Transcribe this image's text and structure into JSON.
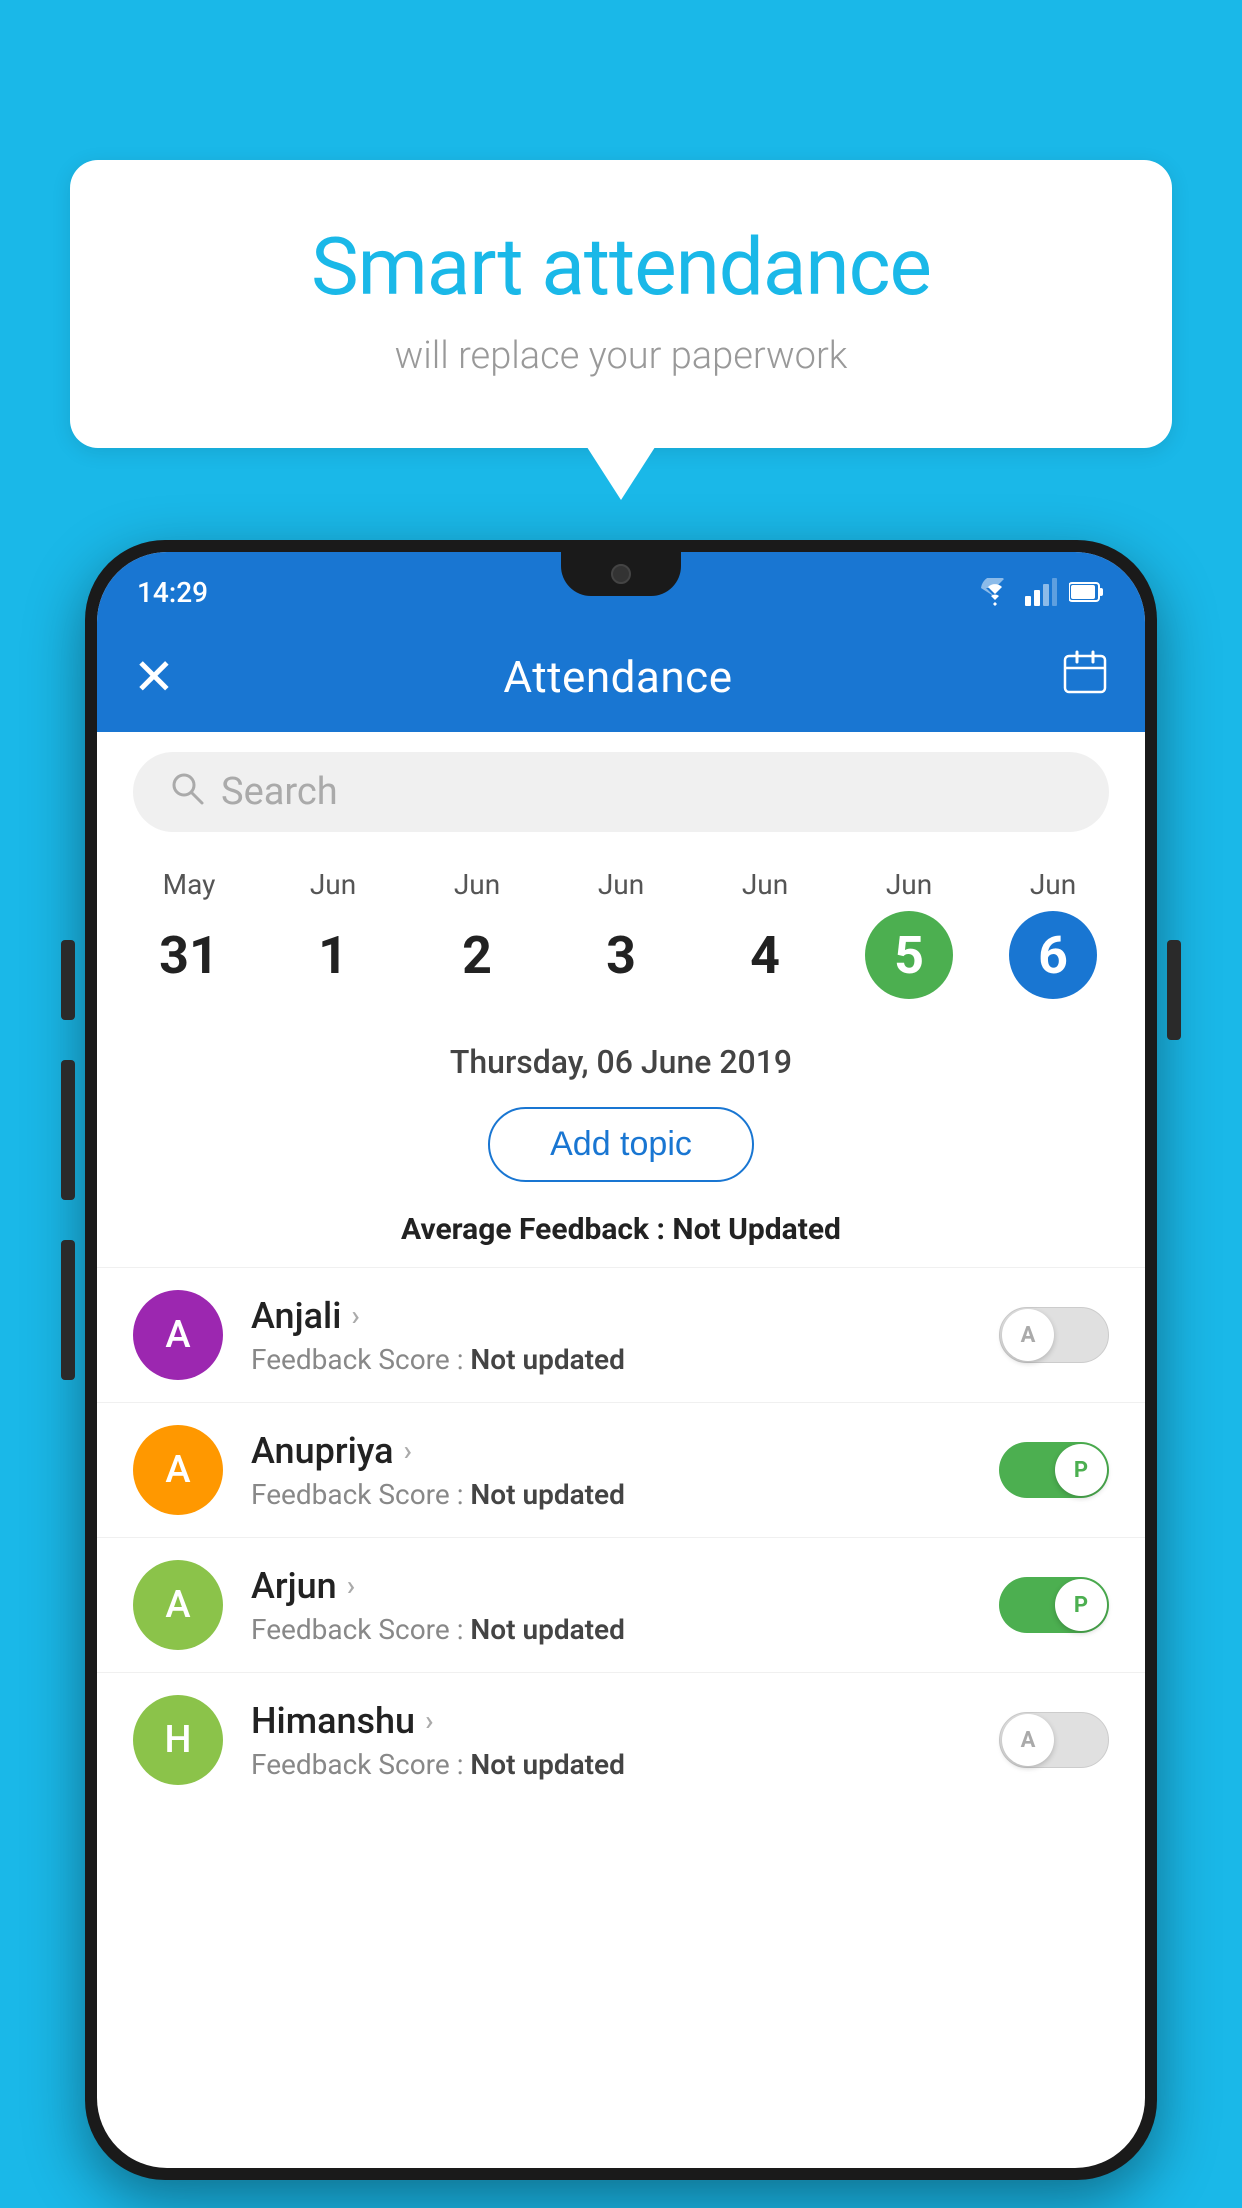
{
  "background_color": "#1ab8e8",
  "bubble": {
    "title": "Smart attendance",
    "subtitle": "will replace your paperwork"
  },
  "status_bar": {
    "time": "14:29",
    "wifi_icon": "wifi",
    "signal_icon": "signal",
    "battery_icon": "battery"
  },
  "app_bar": {
    "title": "Attendance",
    "close_icon": "×",
    "calendar_icon": "📅"
  },
  "search": {
    "placeholder": "Search"
  },
  "calendar": {
    "days": [
      {
        "month": "May",
        "num": "31",
        "style": "normal"
      },
      {
        "month": "Jun",
        "num": "1",
        "style": "normal"
      },
      {
        "month": "Jun",
        "num": "2",
        "style": "normal"
      },
      {
        "month": "Jun",
        "num": "3",
        "style": "normal"
      },
      {
        "month": "Jun",
        "num": "4",
        "style": "normal"
      },
      {
        "month": "Jun",
        "num": "5",
        "style": "green"
      },
      {
        "month": "Jun",
        "num": "6",
        "style": "blue"
      }
    ]
  },
  "selected_date": "Thursday, 06 June 2019",
  "add_topic_label": "Add topic",
  "avg_feedback_label": "Average Feedback : ",
  "avg_feedback_value": "Not Updated",
  "students": [
    {
      "name": "Anjali",
      "avatar_letter": "A",
      "avatar_color": "#9c27b0",
      "feedback": "Not updated",
      "toggle_state": "off",
      "toggle_label": "A"
    },
    {
      "name": "Anupriya",
      "avatar_letter": "A",
      "avatar_color": "#ff9800",
      "feedback": "Not updated",
      "toggle_state": "on",
      "toggle_label": "P"
    },
    {
      "name": "Arjun",
      "avatar_letter": "A",
      "avatar_color": "#8bc34a",
      "feedback": "Not updated",
      "toggle_state": "on",
      "toggle_label": "P"
    },
    {
      "name": "Himanshu",
      "avatar_letter": "H",
      "avatar_color": "#8bc34a",
      "feedback": "Not updated",
      "toggle_state": "off",
      "toggle_label": "A"
    }
  ],
  "feedback_score_label": "Feedback Score : "
}
